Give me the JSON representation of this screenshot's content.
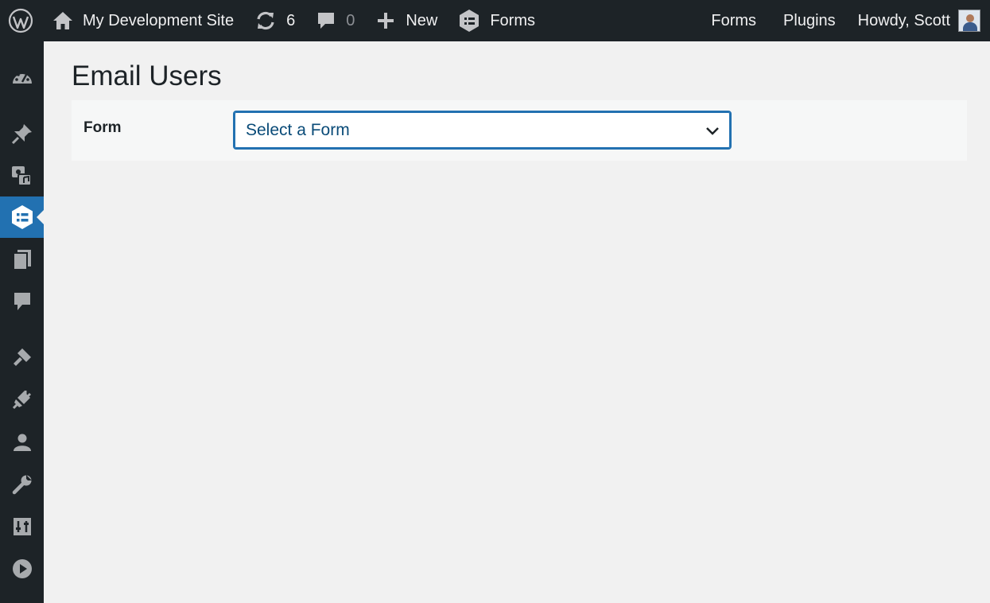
{
  "adminbar": {
    "wp_logo_icon": "wordpress-icon",
    "site_name": "My Development Site",
    "updates_count": "6",
    "comments_count": "0",
    "new_label": "New",
    "forms_label": "Forms",
    "right_forms_label": "Forms",
    "plugins_label": "Plugins",
    "greeting": "Howdy, Scott"
  },
  "sidebar": {
    "items": [
      {
        "icon": "dashboard-icon"
      },
      {
        "icon": "pin-icon"
      },
      {
        "icon": "media-icon"
      },
      {
        "icon": "forms-icon",
        "active": true
      },
      {
        "icon": "pages-icon"
      },
      {
        "icon": "comments-icon"
      },
      {
        "icon": "appearance-icon"
      },
      {
        "icon": "plugins-icon"
      },
      {
        "icon": "users-icon"
      },
      {
        "icon": "tools-icon"
      },
      {
        "icon": "settings-icon"
      },
      {
        "icon": "media-player-icon"
      }
    ]
  },
  "main": {
    "title": "Email Users",
    "form_label": "Form",
    "form_select": {
      "selected": "Select a Form"
    }
  },
  "colors": {
    "adminbar_bg": "#1d2327",
    "accent": "#2271b1",
    "background": "#f1f1f1"
  }
}
